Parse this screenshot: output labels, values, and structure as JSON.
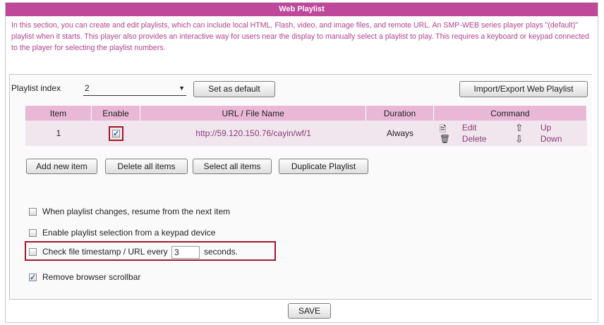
{
  "header": {
    "title": "Web Playlist"
  },
  "intro_text": "In this section, you can create and edit playlists, which can include local HTML, Flash, video, and image files, and remote URL. An SMP-WEB series player plays \"(default)\" playlist when it starts. This player also provides an interactive way for users near the display to manually select a playlist to play. This requires a keyboard or keypad connected to the player for selecting the playlist numbers.",
  "playlist_index": {
    "label": "Playlist index",
    "selected": "2"
  },
  "buttons": {
    "set_default": "Set as default",
    "import_export": "Import/Export Web Playlist",
    "add_new_item": "Add new item",
    "delete_all_items": "Delete all items",
    "select_all_items": "Select all items",
    "duplicate_playlist": "Duplicate Playlist",
    "save": "SAVE"
  },
  "table": {
    "headers": {
      "item": "Item",
      "enable": "Enable",
      "url": "URL / File Name",
      "duration": "Duration",
      "command": "Command"
    },
    "rows": [
      {
        "item": "1",
        "enabled": true,
        "url": "http://59.120.150.76/cayin/wf/1",
        "duration": "Always",
        "commands": {
          "edit": "Edit",
          "delete": "Delete",
          "up": "Up",
          "down": "Down"
        }
      }
    ]
  },
  "options": {
    "resume_next": {
      "label": "When playlist changes, resume from the next item",
      "checked": false
    },
    "keypad_selection": {
      "label": "Enable playlist selection from a keypad device",
      "checked": false
    },
    "check_timestamp": {
      "label": "Check file timestamp / URL every",
      "value": "3",
      "suffix": "seconds.",
      "checked": false
    },
    "remove_scrollbar": {
      "label": "Remove browser scrollbar",
      "checked": true
    }
  },
  "icons": {
    "edit": "document-edit-icon",
    "delete": "trash-icon",
    "up": "arrow-up-icon",
    "down": "arrow-down-icon",
    "dropdown": "chevron-down-icon"
  },
  "colors": {
    "accent": "#c0489a",
    "header_row": "#e9b8d6",
    "data_row": "#f2e6ee",
    "highlight": "#a0182a",
    "link": "#8a3a7a"
  }
}
